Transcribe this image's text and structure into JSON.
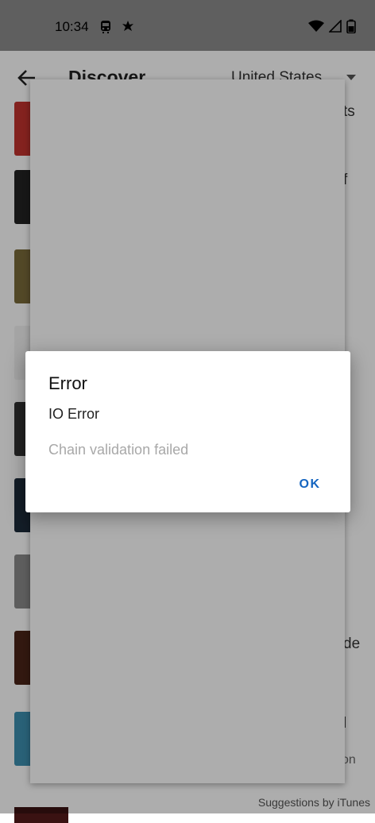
{
  "status_bar": {
    "time": "10:34"
  },
  "toolbar": {
    "title": "Discover",
    "country": "United States"
  },
  "background_rows": [
    {
      "thumb_color": "#c2332e",
      "text": "ts"
    },
    {
      "thumb_color": "#222222",
      "text": "f"
    },
    {
      "thumb_color": "#7a6a3a",
      "text": ""
    },
    {
      "thumb_color": "#f2f2f2",
      "text": ""
    },
    {
      "thumb_color": "#333333",
      "text": ""
    },
    {
      "thumb_color": "#1d2b3a",
      "text": ""
    },
    {
      "thumb_color": "#8a8a8a",
      "text": ""
    },
    {
      "thumb_color": "#4a2418",
      "text": "de"
    },
    {
      "thumb_color": "#3d8fb0",
      "text": "l"
    }
  ],
  "background_row_extra": "on",
  "footer": {
    "text": "Suggestions by iTunes"
  },
  "dialog": {
    "title": "Error",
    "message": "IO Error",
    "detail": "Chain validation failed",
    "ok_label": "OK",
    "accent_color": "#1565c0"
  }
}
